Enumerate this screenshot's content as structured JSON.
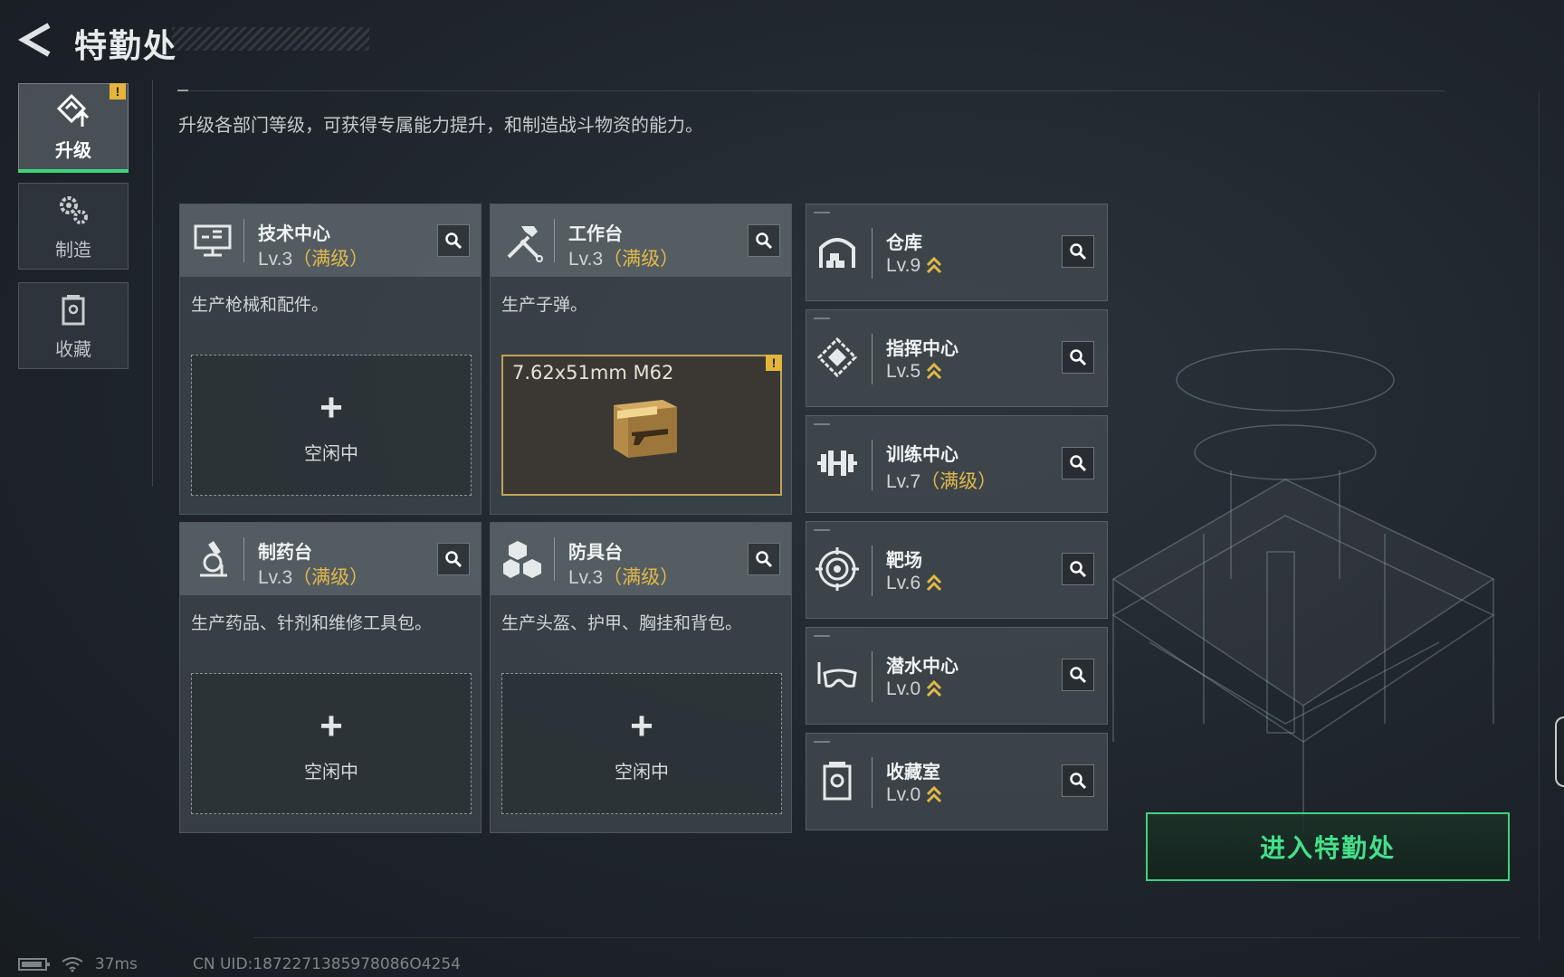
{
  "header": {
    "title": "特勤处"
  },
  "sidebar": {
    "tabs": [
      {
        "label": "升级",
        "active": true,
        "alert": "!"
      },
      {
        "label": "制造",
        "active": false
      },
      {
        "label": "收藏",
        "active": false
      }
    ]
  },
  "description": "升级各部门等级，可获得专属能力提升，和制造战斗物资的能力。",
  "workstations": [
    {
      "name": "技术中心",
      "level": "Lv.3",
      "maxed": "（满级）",
      "desc": "生产枪械和配件。",
      "slot_plus": "+",
      "slot_status": "空闲中"
    },
    {
      "name": "工作台",
      "level": "Lv.3",
      "maxed": "（满级）",
      "desc": "生产子弹。",
      "item_name": "7.62x51mm M62",
      "item_alert": "!"
    },
    {
      "name": "制药台",
      "level": "Lv.3",
      "maxed": "（满级）",
      "desc": "生产药品、针剂和维修工具包。",
      "slot_plus": "+",
      "slot_status": "空闲中"
    },
    {
      "name": "防具台",
      "level": "Lv.3",
      "maxed": "（满级）",
      "desc": "生产头盔、护甲、胸挂和背包。",
      "slot_plus": "+",
      "slot_status": "空闲中"
    }
  ],
  "facilities": [
    {
      "name": "仓库",
      "level": "Lv.9",
      "maxed": "",
      "upgradeable": true
    },
    {
      "name": "指挥中心",
      "level": "Lv.5",
      "maxed": "",
      "upgradeable": true
    },
    {
      "name": "训练中心",
      "level": "Lv.7",
      "maxed": "（满级）",
      "upgradeable": false
    },
    {
      "name": "靶场",
      "level": "Lv.6",
      "maxed": "",
      "upgradeable": true
    },
    {
      "name": "潜水中心",
      "level": "Lv.0",
      "maxed": "",
      "upgradeable": true
    },
    {
      "name": "收藏室",
      "level": "Lv.0",
      "maxed": "",
      "upgradeable": true
    }
  ],
  "enter_button": "进入特勤处",
  "status_bar": {
    "ping": "37ms",
    "uid": "CN UID:1872271385978086O4254"
  },
  "colors": {
    "accent_green": "#3ed37c",
    "max_gold": "#e2b948",
    "alert_yellow": "#e5b53b"
  }
}
